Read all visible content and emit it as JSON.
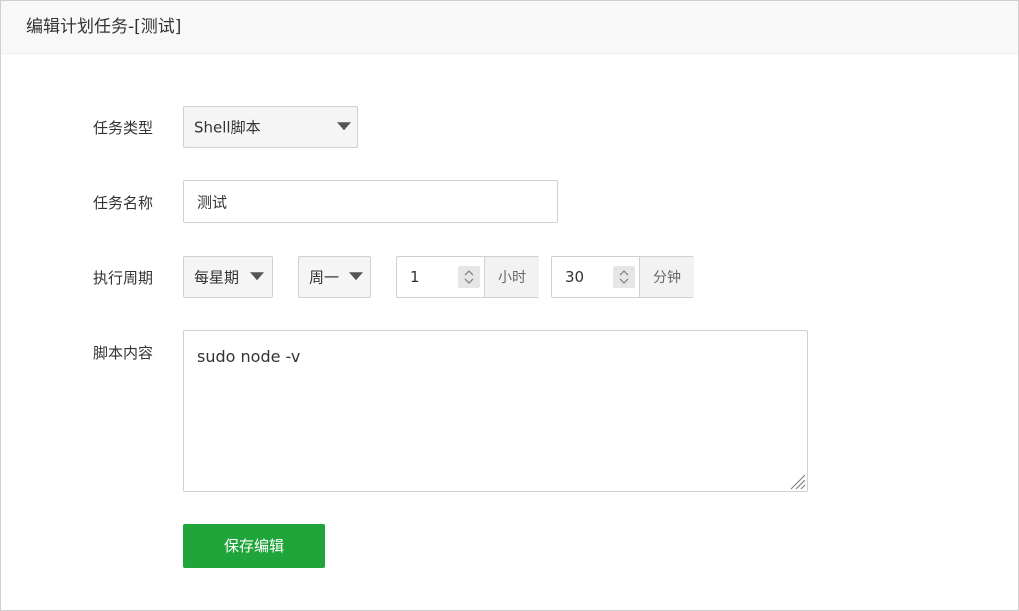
{
  "dialog": {
    "title": "编辑计划任务-[测试]"
  },
  "form": {
    "task_type": {
      "label": "任务类型",
      "value": "Shell脚本"
    },
    "task_name": {
      "label": "任务名称",
      "value": "测试"
    },
    "schedule": {
      "label": "执行周期",
      "frequency": "每星期",
      "weekday": "周一",
      "hour_value": "1",
      "hour_unit": "小时",
      "minute_value": "30",
      "minute_unit": "分钟"
    },
    "script": {
      "label": "脚本内容",
      "content": "sudo node -v"
    },
    "save_label": "保存编辑"
  },
  "colors": {
    "primary_button": "#20a53a",
    "title_bar_bg": "#f8f8f8"
  },
  "icons": {
    "dropdown": "caret-down-icon",
    "spinner": "up-down-arrows-icon",
    "resize": "resize-grip-icon"
  }
}
